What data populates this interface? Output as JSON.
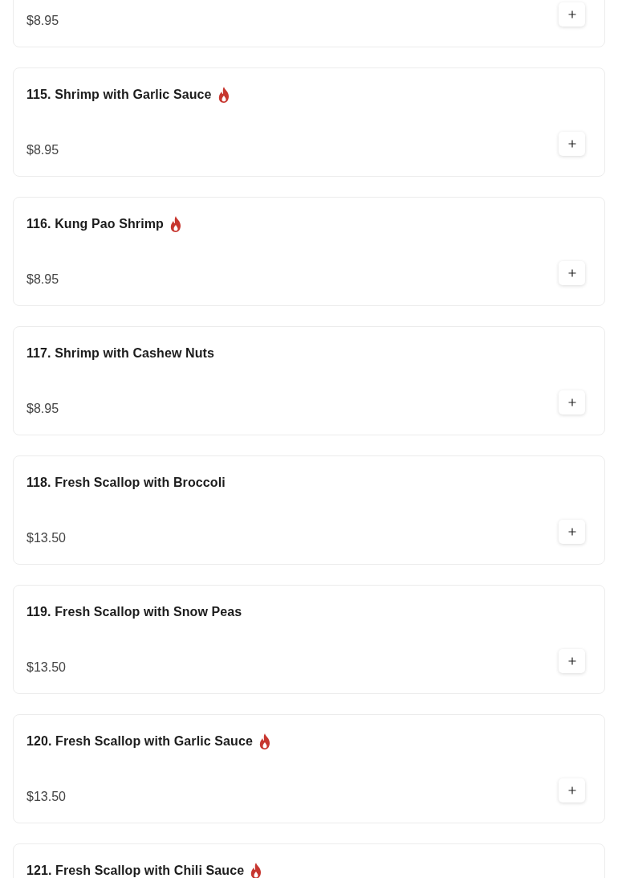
{
  "items": [
    {
      "price": "$8.95"
    },
    {
      "name": "115. Shrimp with Garlic Sauce",
      "price": "$8.95",
      "spicy": true
    },
    {
      "name": "116. Kung Pao Shrimp",
      "price": "$8.95",
      "spicy": true
    },
    {
      "name": "117. Shrimp with Cashew Nuts",
      "price": "$8.95",
      "spicy": false
    },
    {
      "name": "118. Fresh Scallop with Broccoli",
      "price": "$13.50",
      "spicy": false
    },
    {
      "name": "119. Fresh Scallop with Snow Peas",
      "price": "$13.50",
      "spicy": false
    },
    {
      "name": "120. Fresh Scallop with Garlic Sauce",
      "price": "$13.50",
      "spicy": true
    },
    {
      "name": "121. Fresh Scallop with Chili Sauce",
      "spicy": true
    }
  ]
}
